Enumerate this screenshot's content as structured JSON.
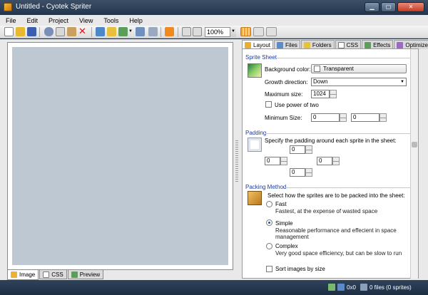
{
  "window": {
    "title": "Untitled - Cyotek Spriter"
  },
  "menu": [
    "File",
    "Edit",
    "Project",
    "View",
    "Tools",
    "Help"
  ],
  "toolbar": {
    "zoom": "100%",
    "icons": [
      "new-icon",
      "open-icon",
      "save-icon",
      "cut-icon",
      "copy-icon",
      "paste-icon",
      "delete-icon",
      "add-images-icon",
      "add-folder-icon",
      "export-icon",
      "refresh-icon",
      "rss-icon",
      "fit-icon",
      "actual-size-icon",
      "grid-icon",
      "background-icon",
      "sheet-icon"
    ]
  },
  "left_tabs": [
    "Image",
    "CSS",
    "Preview"
  ],
  "right_tabs": [
    "Layout",
    "Files",
    "Folders",
    "CSS",
    "Effects",
    "Optimize"
  ],
  "sprite_sheet": {
    "heading": "Sprite Sheet",
    "background_label": "Background color:",
    "background_value": "Transparent",
    "growth_label": "Growth direction:",
    "growth_value": "Down",
    "max_size_label": "Maximum size:",
    "max_size_value": "1024",
    "power_of_two": "Use power of two",
    "min_size_label": "Minimum Size:",
    "min_w": "0",
    "min_h": "0"
  },
  "padding": {
    "heading": "Padding",
    "description": "Specify the padding around each sprite in the sheet:",
    "top": "0",
    "left": "0",
    "right": "0",
    "bottom": "0"
  },
  "packing": {
    "heading": "Packing Method",
    "description": "Select how the sprites are to be packed into the sheet:",
    "options": [
      {
        "label": "Fast",
        "desc": "Fastest, at the expense of wasted space"
      },
      {
        "label": "Simple",
        "desc": "Reasonable performance and effecient in space management"
      },
      {
        "label": "Complex",
        "desc": "Very good space efficiency, but can be slow to run"
      }
    ],
    "selected_index": 1,
    "sort_label": "Sort images by size"
  },
  "status": {
    "dimensions": "0x0",
    "files": "0 files (0 sprites)"
  },
  "colors": {
    "title_bar": "#22354c",
    "canvas_bg": "#bdc8d3",
    "section_heading": "#1f3b9b"
  }
}
